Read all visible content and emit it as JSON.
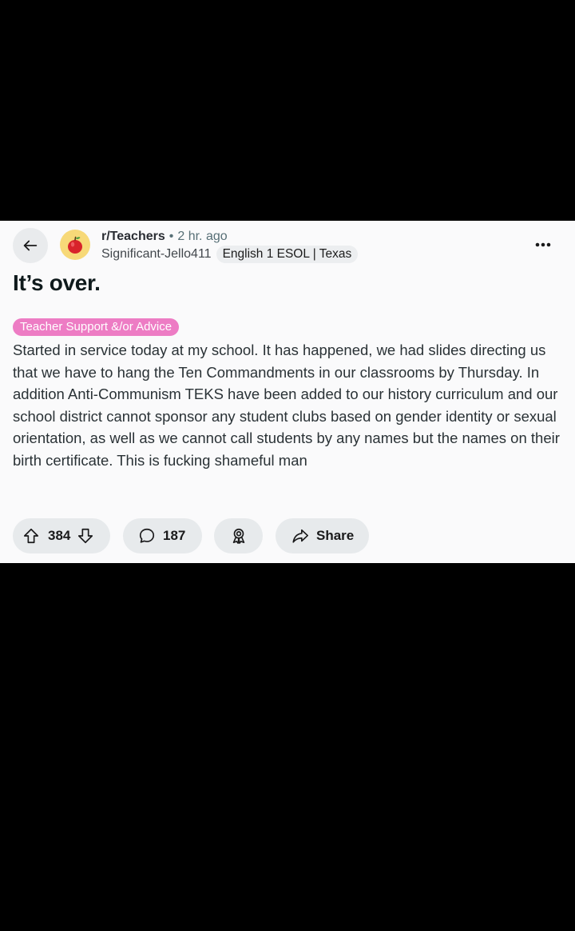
{
  "post": {
    "subreddit": "r/Teachers",
    "separator": "•",
    "time_ago": "2 hr. ago",
    "author": "Significant-Jello411",
    "user_flair": "English 1 ESOL | Texas",
    "title": "It’s over.",
    "post_flair": "Teacher Support &/or Advice",
    "body": "Started in service today at my school. It has happened, we had slides directing us that we have to hang the Ten Commandments in our classrooms by Thursday. In addition Anti-Communism TEKS have been added to our history curriculum and our school district cannot sponsor any student clubs based on gender identity or sexual orientation, as well as we cannot call students by any names but the names on their birth certificate. This is fucking shameful man"
  },
  "actions": {
    "vote_count": "384",
    "comment_count": "187",
    "share_label": "Share"
  },
  "icons": {
    "back": "arrow-left-icon",
    "subreddit_avatar": "apple-icon",
    "more": "more-horizontal-icon",
    "upvote": "arrow-up-icon",
    "downvote": "arrow-down-icon",
    "comment": "speech-bubble-icon",
    "award": "award-icon",
    "share": "share-arrow-icon"
  },
  "colors": {
    "post_background": "#fafafb",
    "page_background": "#000000",
    "post_flair_background": "#ed7cc4",
    "pill_background": "#e7eaec",
    "avatar_background": "#f7d978"
  }
}
